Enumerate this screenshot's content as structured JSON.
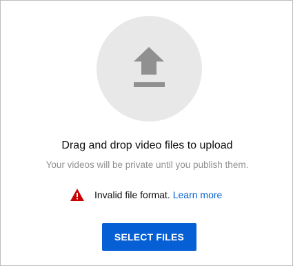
{
  "upload": {
    "icon": "upload-arrow-icon",
    "title": "Drag and drop video files to upload",
    "subtitle": "Your videos will be private until you publish them."
  },
  "error": {
    "icon": "warning-icon",
    "message": "Invalid file format.",
    "link_label": "Learn more"
  },
  "actions": {
    "select_label": "SELECT FILES"
  },
  "colors": {
    "accent": "#065fd4",
    "warning": "#cc0000",
    "circle_bg": "#e8e8e8",
    "icon_gray": "#909090"
  }
}
